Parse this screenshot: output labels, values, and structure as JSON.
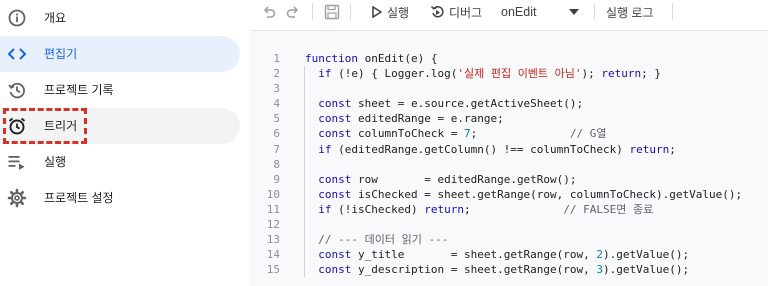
{
  "sidebar": {
    "items": [
      {
        "label": "개요",
        "icon": "info-icon"
      },
      {
        "label": "편집기",
        "icon": "code-icon"
      },
      {
        "label": "프로젝트 기록",
        "icon": "history-icon"
      },
      {
        "label": "트리거",
        "icon": "alarm-clock-icon"
      },
      {
        "label": "실행",
        "icon": "executions-list-icon"
      },
      {
        "label": "프로젝트 설정",
        "icon": "gear-icon"
      }
    ],
    "active_item": "편집기",
    "highlighted_item": "트리거"
  },
  "toolbar": {
    "run_label": "실행",
    "debug_label": "디버그",
    "function_select": "onEdit",
    "log_label": "실행 로그"
  },
  "editor": {
    "lines": [
      {
        "n": "1",
        "text": "function onEdit(e) {"
      },
      {
        "n": "2",
        "text": "  if (!e) { Logger.log('실제 편집 이벤트 아님'); return; }"
      },
      {
        "n": "3",
        "text": ""
      },
      {
        "n": "4",
        "text": "  const sheet = e.source.getActiveSheet();"
      },
      {
        "n": "5",
        "text": "  const editedRange = e.range;"
      },
      {
        "n": "6",
        "text": "  const columnToCheck = 7;              // G열"
      },
      {
        "n": "7",
        "text": "  if (editedRange.getColumn() !== columnToCheck) return;"
      },
      {
        "n": "8",
        "text": ""
      },
      {
        "n": "9",
        "text": "  const row       = editedRange.getRow();"
      },
      {
        "n": "10",
        "text": "  const isChecked = sheet.getRange(row, columnToCheck).getValue();"
      },
      {
        "n": "11",
        "text": "  if (!isChecked) return;              // FALSE면 종료"
      },
      {
        "n": "12",
        "text": ""
      },
      {
        "n": "13",
        "text": "  // --- 데이터 읽기 ---"
      },
      {
        "n": "14",
        "text": "  const y_title       = sheet.getRange(row, 2).getValue();"
      },
      {
        "n": "15",
        "text": "  const y_description = sheet.getRange(row, 3).getValue();"
      }
    ]
  },
  "colors": {
    "active_nav_bg": "#e8f0fe",
    "active_nav_text": "#1967d2",
    "highlight_border": "#d93025",
    "editor_bg": "#f8f9fa",
    "keyword": "#1a0dab",
    "string": "#c5221f",
    "number": "#098591",
    "comment": "#5f6368"
  }
}
